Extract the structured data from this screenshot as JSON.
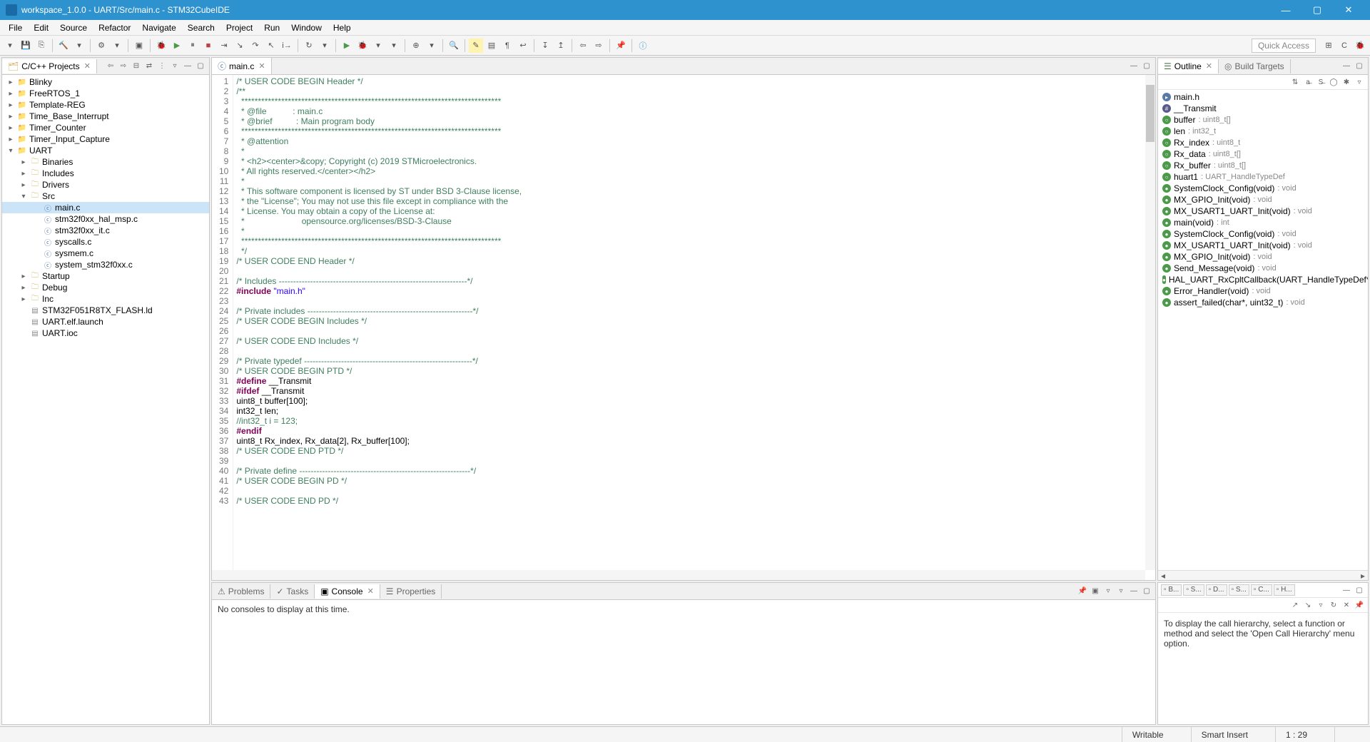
{
  "window": {
    "title": "workspace_1.0.0 - UART/Src/main.c - STM32CubeIDE"
  },
  "menu": [
    "File",
    "Edit",
    "Source",
    "Refactor",
    "Navigate",
    "Search",
    "Project",
    "Run",
    "Window",
    "Help"
  ],
  "quick_access": "Quick Access",
  "projects": {
    "tab": "C/C++ Projects",
    "tree": [
      {
        "d": 0,
        "t": "c",
        "ico": "proj",
        "n": "Blinky"
      },
      {
        "d": 0,
        "t": "c",
        "ico": "proj",
        "n": "FreeRTOS_1"
      },
      {
        "d": 0,
        "t": "c",
        "ico": "proj",
        "n": "Template-REG"
      },
      {
        "d": 0,
        "t": "c",
        "ico": "proj",
        "n": "Time_Base_Interrupt"
      },
      {
        "d": 0,
        "t": "c",
        "ico": "proj",
        "n": "Timer_Counter"
      },
      {
        "d": 0,
        "t": "c",
        "ico": "proj",
        "n": "Timer_Input_Capture"
      },
      {
        "d": 0,
        "t": "o",
        "ico": "proj",
        "n": "UART"
      },
      {
        "d": 1,
        "t": "c",
        "ico": "folder",
        "n": "Binaries"
      },
      {
        "d": 1,
        "t": "c",
        "ico": "folder",
        "n": "Includes"
      },
      {
        "d": 1,
        "t": "c",
        "ico": "folder",
        "n": "Drivers"
      },
      {
        "d": 1,
        "t": "o",
        "ico": "folder",
        "n": "Src"
      },
      {
        "d": 2,
        "t": "",
        "ico": "c",
        "n": "main.c",
        "sel": true
      },
      {
        "d": 2,
        "t": "",
        "ico": "c",
        "n": "stm32f0xx_hal_msp.c"
      },
      {
        "d": 2,
        "t": "",
        "ico": "c",
        "n": "stm32f0xx_it.c"
      },
      {
        "d": 2,
        "t": "",
        "ico": "c",
        "n": "syscalls.c"
      },
      {
        "d": 2,
        "t": "",
        "ico": "c",
        "n": "sysmem.c"
      },
      {
        "d": 2,
        "t": "",
        "ico": "c",
        "n": "system_stm32f0xx.c"
      },
      {
        "d": 1,
        "t": "c",
        "ico": "folder",
        "n": "Startup"
      },
      {
        "d": 1,
        "t": "c",
        "ico": "folder",
        "n": "Debug"
      },
      {
        "d": 1,
        "t": "c",
        "ico": "folder",
        "n": "Inc"
      },
      {
        "d": 1,
        "t": "",
        "ico": "file",
        "n": "STM32F051R8TX_FLASH.ld"
      },
      {
        "d": 1,
        "t": "",
        "ico": "file",
        "n": "UART.elf.launch"
      },
      {
        "d": 1,
        "t": "",
        "ico": "file",
        "n": "UART.ioc"
      }
    ]
  },
  "editor": {
    "tab": "main.c",
    "lines": [
      {
        "n": 1,
        "cls": "c-comment",
        "t": "/* USER CODE BEGIN Header */"
      },
      {
        "n": 2,
        "cls": "c-comment",
        "t": "/**"
      },
      {
        "n": 3,
        "cls": "c-comment",
        "t": "  ******************************************************************************"
      },
      {
        "n": 4,
        "cls": "c-comment",
        "t": "  * @file           : main.c"
      },
      {
        "n": 5,
        "cls": "c-comment",
        "t": "  * @brief          : Main program body"
      },
      {
        "n": 6,
        "cls": "c-comment",
        "t": "  ******************************************************************************"
      },
      {
        "n": 7,
        "cls": "c-comment",
        "t": "  * @attention"
      },
      {
        "n": 8,
        "cls": "c-comment",
        "t": "  *"
      },
      {
        "n": 9,
        "cls": "c-comment",
        "t": "  * <h2><center>&copy; Copyright (c) 2019 STMicroelectronics."
      },
      {
        "n": 10,
        "cls": "c-comment",
        "t": "  * All rights reserved.</center></h2>"
      },
      {
        "n": 11,
        "cls": "c-comment",
        "t": "  *"
      },
      {
        "n": 12,
        "cls": "c-comment",
        "t": "  * This software component is licensed by ST under BSD 3-Clause license,"
      },
      {
        "n": 13,
        "cls": "c-comment",
        "t": "  * the \"License\"; You may not use this file except in compliance with the"
      },
      {
        "n": 14,
        "cls": "c-comment",
        "t": "  * License. You may obtain a copy of the License at:"
      },
      {
        "n": 15,
        "cls": "c-comment",
        "t": "  *                        opensource.org/licenses/BSD-3-Clause"
      },
      {
        "n": 16,
        "cls": "c-comment",
        "t": "  *"
      },
      {
        "n": 17,
        "cls": "c-comment",
        "t": "  ******************************************************************************"
      },
      {
        "n": 18,
        "cls": "c-comment",
        "t": "  */"
      },
      {
        "n": 19,
        "cls": "c-comment",
        "t": "/* USER CODE END Header */"
      },
      {
        "n": 20,
        "cls": "",
        "t": ""
      },
      {
        "n": 21,
        "cls": "c-comment",
        "t": "/* Includes ------------------------------------------------------------------*/"
      },
      {
        "n": 22,
        "cls": "",
        "html": "<span class='c-keyword'>#include</span> <span class='c-string'>\"main.h\"</span>"
      },
      {
        "n": 23,
        "cls": "",
        "t": ""
      },
      {
        "n": 24,
        "cls": "c-comment",
        "t": "/* Private includes ----------------------------------------------------------*/"
      },
      {
        "n": 25,
        "cls": "c-comment",
        "t": "/* USER CODE BEGIN Includes */"
      },
      {
        "n": 26,
        "cls": "",
        "t": ""
      },
      {
        "n": 27,
        "cls": "c-comment",
        "t": "/* USER CODE END Includes */"
      },
      {
        "n": 28,
        "cls": "",
        "t": ""
      },
      {
        "n": 29,
        "cls": "c-comment",
        "t": "/* Private typedef -----------------------------------------------------------*/"
      },
      {
        "n": 30,
        "cls": "c-comment",
        "t": "/* USER CODE BEGIN PTD */"
      },
      {
        "n": 31,
        "cls": "",
        "html": "<span class='c-keyword'>#define</span> __Transmit"
      },
      {
        "n": 32,
        "cls": "",
        "html": "<span class='c-keyword'>#ifdef</span> __Transmit"
      },
      {
        "n": 33,
        "cls": "",
        "t": "uint8_t buffer[100];"
      },
      {
        "n": 34,
        "cls": "",
        "t": "int32_t len;"
      },
      {
        "n": 35,
        "cls": "c-comment",
        "t": "//int32_t i = 123;"
      },
      {
        "n": 36,
        "cls": "",
        "html": "<span class='c-keyword'>#endif</span>"
      },
      {
        "n": 37,
        "cls": "",
        "t": "uint8_t Rx_index, Rx_data[2], Rx_buffer[100];"
      },
      {
        "n": 38,
        "cls": "c-comment",
        "t": "/* USER CODE END PTD */"
      },
      {
        "n": 39,
        "cls": "",
        "t": ""
      },
      {
        "n": 40,
        "cls": "c-comment",
        "t": "/* Private define ------------------------------------------------------------*/"
      },
      {
        "n": 41,
        "cls": "c-comment",
        "t": "/* USER CODE BEGIN PD */"
      },
      {
        "n": 42,
        "cls": "",
        "t": ""
      },
      {
        "n": 43,
        "cls": "c-comment",
        "t": "/* USER CODE END PD */"
      }
    ]
  },
  "console": {
    "tabs": [
      "Problems",
      "Tasks",
      "Console",
      "Properties"
    ],
    "active": 2,
    "msg": "No consoles to display at this time."
  },
  "outline": {
    "tab": "Outline",
    "tab2": "Build Targets",
    "items": [
      {
        "ico": "inc",
        "n": "main.h",
        "t": ""
      },
      {
        "ico": "def",
        "n": "__Transmit",
        "t": ""
      },
      {
        "ico": "var",
        "n": "buffer",
        "t": ": uint8_t[]"
      },
      {
        "ico": "var",
        "n": "len",
        "t": ": int32_t"
      },
      {
        "ico": "var",
        "n": "Rx_index",
        "t": ": uint8_t"
      },
      {
        "ico": "var",
        "n": "Rx_data",
        "t": ": uint8_t[]"
      },
      {
        "ico": "var",
        "n": "Rx_buffer",
        "t": ": uint8_t[]"
      },
      {
        "ico": "var",
        "n": "huart1",
        "t": ": UART_HandleTypeDef"
      },
      {
        "ico": "fn",
        "n": "SystemClock_Config(void)",
        "t": ": void"
      },
      {
        "ico": "fn",
        "n": "MX_GPIO_Init(void)",
        "t": ": void"
      },
      {
        "ico": "fn",
        "n": "MX_USART1_UART_Init(void)",
        "t": ": void"
      },
      {
        "ico": "fn",
        "n": "main(void)",
        "t": ": int"
      },
      {
        "ico": "fn",
        "n": "SystemClock_Config(void)",
        "t": ": void"
      },
      {
        "ico": "fn",
        "n": "MX_USART1_UART_Init(void)",
        "t": ": void"
      },
      {
        "ico": "fn",
        "n": "MX_GPIO_Init(void)",
        "t": ": void"
      },
      {
        "ico": "fn",
        "n": "Send_Message(void)",
        "t": ": void"
      },
      {
        "ico": "fn",
        "n": "HAL_UART_RxCpltCallback(UART_HandleTypeDef*)",
        "t": ": void"
      },
      {
        "ico": "fn",
        "n": "Error_Handler(void)",
        "t": ": void"
      },
      {
        "ico": "fn",
        "n": "assert_failed(char*, uint32_t)",
        "t": ": void"
      }
    ]
  },
  "hierarchy": {
    "tabs": [
      "B...",
      "S...",
      "D...",
      "S...",
      "C...",
      "H..."
    ],
    "msg": "To display the call hierarchy, select a function or method and select the 'Open Call Hierarchy' menu option."
  },
  "status": {
    "writable": "Writable",
    "insert": "Smart Insert",
    "pos": "1 : 29"
  }
}
